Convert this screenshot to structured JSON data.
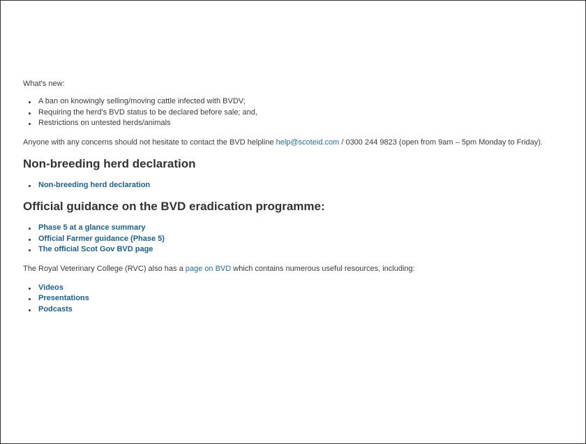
{
  "whats_new": {
    "label": "What's new:",
    "items": [
      "A ban on knowingly selling/moving cattle infected with BVDV;",
      "Requiring the herd's BVD status to be declared before sale; and,",
      "Restrictions on untested herds/animals"
    ]
  },
  "contact": {
    "text_before": "Anyone with any concerns should not hesitate to contact the BVD helpline ",
    "email": "help@scoteid.com",
    "text_after": " / 0300 244 9823 (open from 9am – 5pm Monday to Friday)."
  },
  "non_breeding": {
    "heading": "Non-breeding herd declaration",
    "links": [
      "Non-breeding herd declaration"
    ]
  },
  "guidance": {
    "heading": "Official guidance on the BVD eradication programme:",
    "links": [
      "Phase 5 at a glance summary",
      "Official Farmer guidance (Phase 5)",
      "The official Scot Gov BVD page"
    ]
  },
  "rvc": {
    "text_before": "The Royal Veterinary College (RVC) also has a ",
    "link": "page on BVD",
    "text_after": " which contains numerous useful resources, including:",
    "links": [
      "Videos",
      "Presentations",
      "Podcasts"
    ]
  },
  "colors": {
    "link": "#1e6f96",
    "text": "#3a3a3a"
  }
}
